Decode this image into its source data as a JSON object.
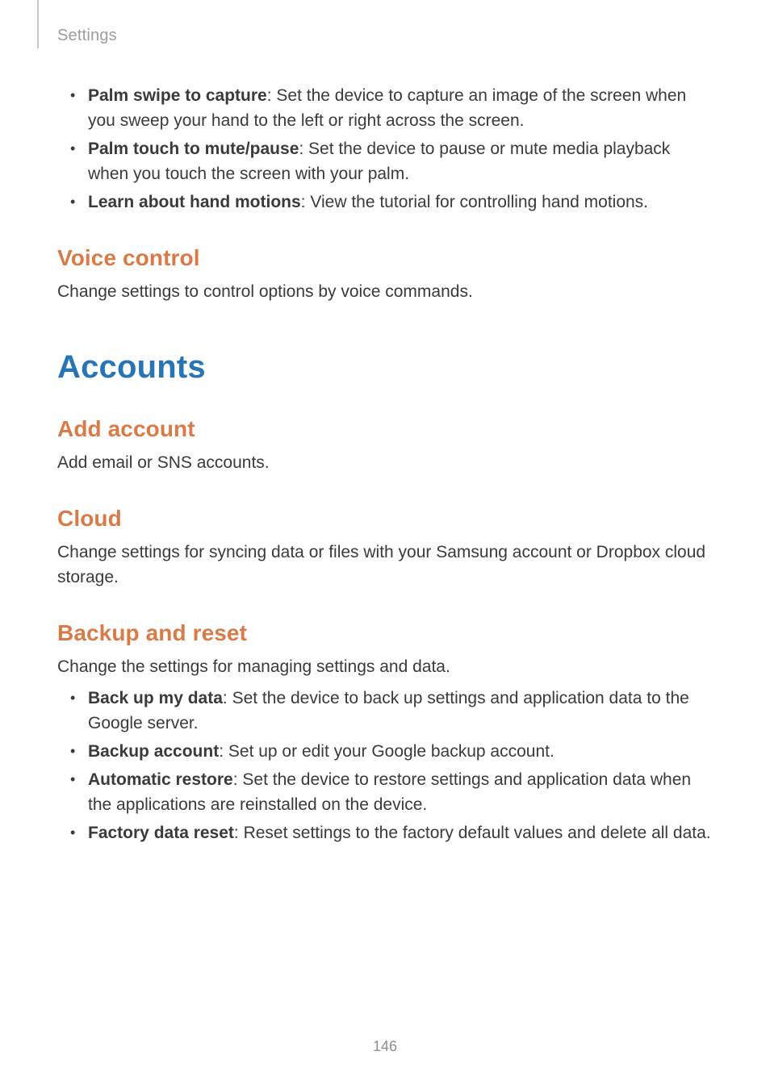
{
  "header": {
    "breadcrumb": "Settings"
  },
  "top_bullets": [
    {
      "bold": "Palm swipe to capture",
      "rest": ": Set the device to capture an image of the screen when you sweep your hand to the left or right across the screen."
    },
    {
      "bold": "Palm touch to mute/pause",
      "rest": ": Set the device to pause or mute media playback when you touch the screen with your palm."
    },
    {
      "bold": "Learn about hand motions",
      "rest": ": View the tutorial for controlling hand motions."
    }
  ],
  "voice_control": {
    "heading": "Voice control",
    "body": "Change settings to control options by voice commands."
  },
  "accounts_heading": "Accounts",
  "add_account": {
    "heading": "Add account",
    "body": "Add email or SNS accounts."
  },
  "cloud": {
    "heading": "Cloud",
    "body": "Change settings for syncing data or files with your Samsung account or Dropbox cloud storage."
  },
  "backup_reset": {
    "heading": "Backup and reset",
    "body": "Change the settings for managing settings and data.",
    "bullets": [
      {
        "bold": "Back up my data",
        "rest": ": Set the device to back up settings and application data to the Google server."
      },
      {
        "bold": "Backup account",
        "rest": ": Set up or edit your Google backup account."
      },
      {
        "bold": "Automatic restore",
        "rest": ": Set the device to restore settings and application data when the applications are reinstalled on the device."
      },
      {
        "bold": "Factory data reset",
        "rest": ": Reset settings to the factory default values and delete all data."
      }
    ]
  },
  "page_number": "146"
}
